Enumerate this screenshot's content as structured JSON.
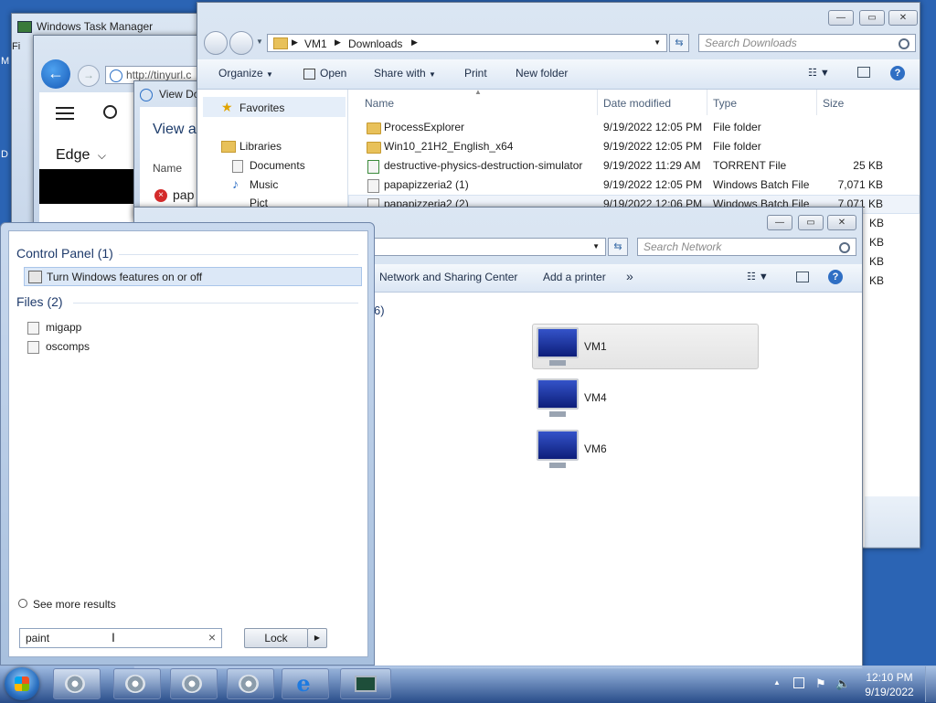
{
  "task_manager": {
    "title": "Windows Task Manager",
    "menu_first": "Fi"
  },
  "browser": {
    "url": "http://tinyurl.c",
    "menu_label": "Edge",
    "list_header": "Name",
    "item_name": "pap"
  },
  "view_downloads": {
    "title": "View Do",
    "heading": "View a"
  },
  "desktop_letters": [
    "M",
    "D"
  ],
  "explorer_downloads": {
    "breadcrumb": [
      "VM1",
      "Downloads"
    ],
    "search_placeholder": "Search Downloads",
    "toolbar": {
      "organize": "Organize",
      "open": "Open",
      "share_with": "Share with",
      "print": "Print",
      "new_folder": "New folder"
    },
    "nav": {
      "favorites": "Favorites",
      "libraries": "Libraries",
      "documents": "Documents",
      "music": "Music",
      "pictures": "Pict"
    },
    "columns": {
      "name": "Name",
      "date": "Date modified",
      "type": "Type",
      "size": "Size"
    },
    "files": [
      {
        "name": "ProcessExplorer",
        "date": "9/19/2022 12:05 PM",
        "type": "File folder",
        "size": ""
      },
      {
        "name": "Win10_21H2_English_x64",
        "date": "9/19/2022 12:05 PM",
        "type": "File folder",
        "size": ""
      },
      {
        "name": "destructive-physics-destruction-simulator",
        "date": "9/19/2022 11:29 AM",
        "type": "TORRENT File",
        "size": "25 KB"
      },
      {
        "name": "papapizzeria2 (1)",
        "date": "9/19/2022 12:05 PM",
        "type": "Windows Batch File",
        "size": "7,071 KB"
      },
      {
        "name": "papapizzeria2 (2)",
        "date": "9/19/2022 12:06 PM",
        "type": "Windows Batch File",
        "size": "7,071 KB"
      }
    ],
    "partial_sizes": [
      "KB",
      "KB",
      "KB",
      "KB",
      "KB"
    ]
  },
  "explorer_network": {
    "search_placeholder": "Search Network",
    "toolbar": {
      "network_sharing": "Network and Sharing Center",
      "add_printer": "Add a printer",
      "more": "»"
    },
    "group_count": "6)",
    "computers": [
      "VM1",
      "VM4",
      "VM6"
    ]
  },
  "start_search": {
    "groups": [
      {
        "header": "Control Panel (1)",
        "items": [
          "Turn Windows features on or off"
        ]
      },
      {
        "header": "Files (2)",
        "items": [
          "migapp",
          "oscomps"
        ]
      }
    ],
    "see_more": "See more results",
    "query": "paint",
    "clear": "×",
    "lock_label": "Lock",
    "lock_arrow": "▶"
  },
  "taskbar": {
    "time": "12:10 PM",
    "date": "9/19/2022",
    "tray_chevron": "▲"
  },
  "colors": {
    "desktop": "#2b64b4",
    "selection": "#dce8f7",
    "taskbar": "#1f3f75"
  }
}
